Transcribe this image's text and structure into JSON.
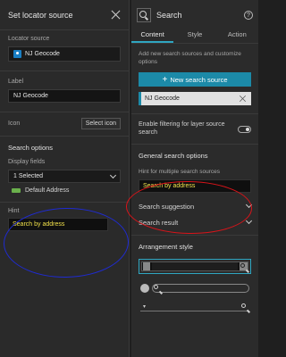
{
  "left": {
    "title": "Set locator source",
    "locator_source_label": "Locator source",
    "locator_source_value": "NJ Geocode",
    "label_label": "Label",
    "label_value": "NJ Geocode",
    "icon_label": "Icon",
    "select_icon_label": "Select icon",
    "search_options_label": "Search options",
    "display_fields_label": "Display fields",
    "display_fields_value": "1 Selected",
    "display_field_item": "Default Address",
    "hint_label": "Hint",
    "hint_value": "Search by address"
  },
  "right": {
    "title": "Search",
    "help_glyph": "?",
    "tabs": [
      "Content",
      "Style",
      "Action"
    ],
    "intro": "Add new search sources and customize options",
    "new_source_label": "New search source",
    "source_item": "NJ Geocode",
    "filter_label": "Enable filtering for layer source search",
    "general_label": "General search options",
    "hint_multi_label": "Hint for multiple search sources",
    "hint_multi_value": "Search by address",
    "suggestion_label": "Search suggestion",
    "result_label": "Search result",
    "arrangement_label": "Arrangement style"
  },
  "colors": {
    "accent": "#2fa6c1",
    "button": "#1c8aa8",
    "hint_text": "#f0e04a",
    "annotation_blue": "#1f2bd1",
    "annotation_red": "#d9141a"
  }
}
